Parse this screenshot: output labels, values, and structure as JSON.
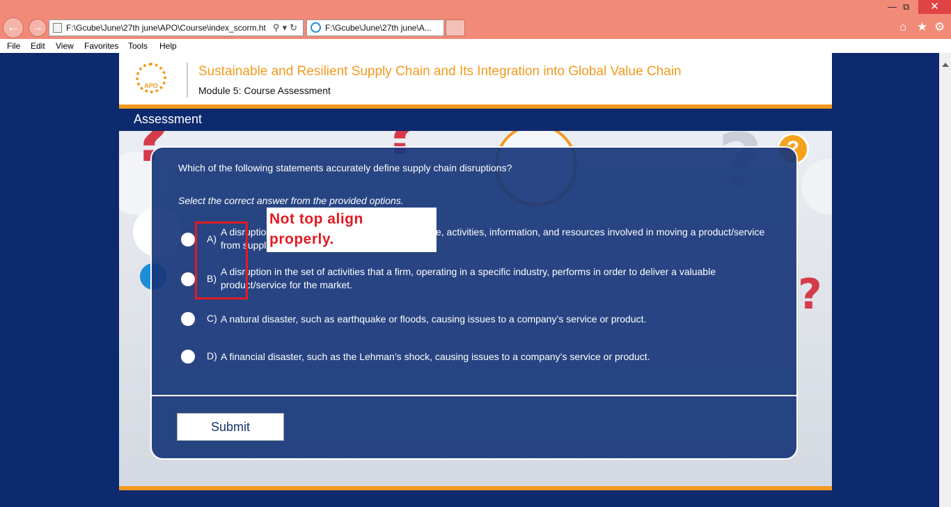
{
  "browser": {
    "address_url": "F:\\Gcube\\June\\27th june\\APO\\Course\\index_scorm.ht",
    "tab_title": "F:\\Gcube\\June\\27th june\\A...",
    "menu": [
      "File",
      "Edit",
      "View",
      "Favorites",
      "Tools",
      "Help"
    ]
  },
  "course": {
    "logo_text": "APO",
    "title": "Sustainable and Resilient Supply Chain and Its Integration into Global Value Chain",
    "module": "Module 5: Course Assessment",
    "section": "Assessment"
  },
  "quiz": {
    "question": "Which of the following statements accurately define supply chain disruptions?",
    "instruction": "Select the correct answer from the provided options.",
    "options": [
      {
        "letter": "A)",
        "text": "A disruption in the network of organizations, people, activities, information, and resources involved in moving a product/service from supplier to customer."
      },
      {
        "letter": "B)",
        "text": "A disruption in the set of activities that a firm, operating in a specific industry, performs in order to deliver a valuable product/service for the market."
      },
      {
        "letter": "C)",
        "text": "A natural disaster, such as earthquake or floods, causing issues to a company’s service or product."
      },
      {
        "letter": "D)",
        "text": "A financial disaster, such as the Lehman’s shock, causing issues to a company’s service or product."
      }
    ],
    "submit_label": "Submit"
  },
  "annotation": {
    "line1": "Not top align",
    "line2": "properly."
  },
  "colors": {
    "brand_orange": "#f29a1f",
    "navy": "#0d2a6e",
    "annotation_red": "#e31b23",
    "titlebar": "#f28a78"
  }
}
